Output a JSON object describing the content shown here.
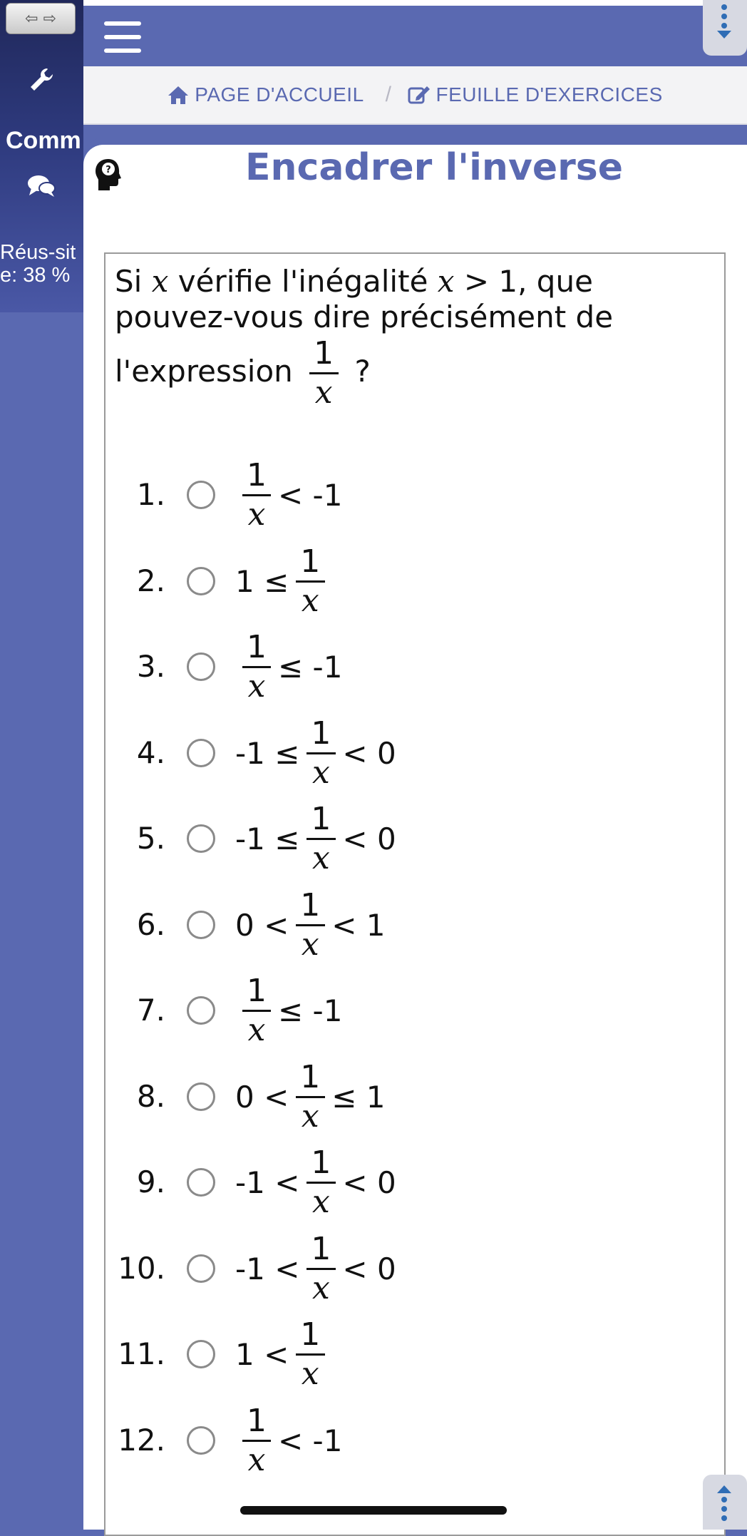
{
  "sidebar": {
    "comm_label": "Comm",
    "success": "Réus-site: 38 %"
  },
  "breadcrumb": {
    "home": "PAGE D'ACCUEIL",
    "exercises": "FEUILLE D'EXERCICES"
  },
  "page": {
    "title": "Encadrer l'inverse"
  },
  "question": {
    "text_a": "Si",
    "var": "x",
    "text_b": "vérifie l'inégalité",
    "cond": "> 1, que pouvez-vous dire précisément de l'expression",
    "frac_num": "1",
    "frac_den": "x",
    "end": "?"
  },
  "options": [
    {
      "num": "1.",
      "pre": "",
      "post": "< -1"
    },
    {
      "num": "2.",
      "pre": "1 ≤",
      "post": ""
    },
    {
      "num": "3.",
      "pre": "",
      "post": "≤ -1"
    },
    {
      "num": "4.",
      "pre": "-1 ≤",
      "post": "< 0"
    },
    {
      "num": "5.",
      "pre": "-1 ≤",
      "post": "< 0"
    },
    {
      "num": "6.",
      "pre": "0 <",
      "post": "< 1"
    },
    {
      "num": "7.",
      "pre": "",
      "post": "≤ -1"
    },
    {
      "num": "8.",
      "pre": "0 <",
      "post": "≤ 1"
    },
    {
      "num": "9.",
      "pre": "-1 <",
      "post": "< 0"
    },
    {
      "num": "10.",
      "pre": "-1 <",
      "post": "< 0"
    },
    {
      "num": "11.",
      "pre": "1 <",
      "post": ""
    },
    {
      "num": "12.",
      "pre": "",
      "post": "< -1"
    }
  ],
  "fraction": {
    "num": "1",
    "den": "x"
  },
  "icons": [
    "arrows-icon",
    "wrench-icon",
    "chat-icon",
    "home-icon",
    "edit-icon",
    "head-question-icon",
    "kebab-menu-icon",
    "scroll-up-icon"
  ],
  "colors": {
    "accent": "#5a69b1",
    "sidebar_dark": "#20285a"
  }
}
